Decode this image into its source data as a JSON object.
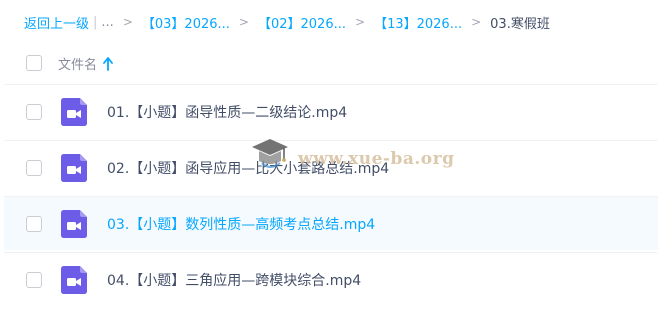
{
  "breadcrumb": {
    "back_label": "返回上一级",
    "separator": "|",
    "ellipsis": "...",
    "arrow": ">",
    "crumbs": [
      "【03】2026...",
      "【02】2026...",
      "【13】2026..."
    ],
    "current": "03.寒假班"
  },
  "list_header": {
    "name_column": "文件名",
    "sort_icon": "arrow-up-icon"
  },
  "files": [
    {
      "name": "01.【小题】函导性质—二级结论.mp4",
      "icon": "video-file-icon",
      "selected": false
    },
    {
      "name": "02.【小题】函导应用—比大小套路总结.mp4",
      "icon": "video-file-icon",
      "selected": false
    },
    {
      "name": "03.【小题】数列性质—高频考点总结.mp4",
      "icon": "video-file-icon",
      "selected": true
    },
    {
      "name": "04.【小题】三角应用—跨模块综合.mp4",
      "icon": "video-file-icon",
      "selected": false
    }
  ],
  "watermark": {
    "text": "www.xue-ba.org",
    "icon": "graduation-cap-icon"
  },
  "colors": {
    "accent": "#06a7ff",
    "text": "#424e67",
    "muted": "#878c9c",
    "video_icon": "#6c5ce7",
    "selected_row": "#f5faff"
  }
}
